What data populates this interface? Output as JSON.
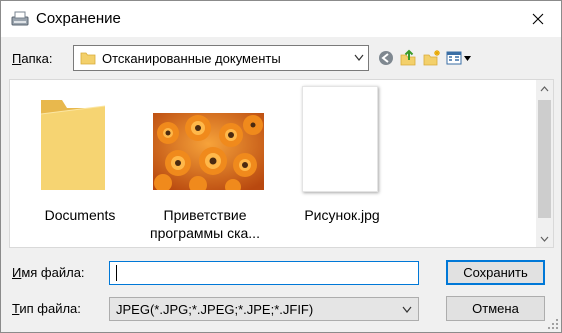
{
  "window": {
    "title": "Сохранение"
  },
  "folder": {
    "label_prefix": "",
    "label_hotkey": "П",
    "label_rest": "апка:",
    "current": "Отсканированные документы"
  },
  "files": [
    {
      "name_line1": "Documents",
      "name_line2": "",
      "kind": "folder"
    },
    {
      "name_line1": "Приветствие",
      "name_line2": "программы ска...",
      "kind": "image"
    },
    {
      "name_line1": "Рисунок.jpg",
      "name_line2": "",
      "kind": "blank"
    }
  ],
  "filename": {
    "label_hotkey": "И",
    "label_rest": "мя файла:",
    "value": ""
  },
  "filetype": {
    "label_hotkey": "Т",
    "label_rest": "ип файла:",
    "value": "JPEG(*.JPG;*.JPEG;*.JPE;*.JFIF)"
  },
  "buttons": {
    "save": "Сохранить",
    "cancel": "Отмена"
  },
  "colors": {
    "accent": "#0078d7",
    "folder_yellow": "#f3d06b"
  },
  "icons": [
    "scanner-icon",
    "close-icon",
    "folder-icon",
    "back-icon",
    "up-folder-icon",
    "new-folder-icon",
    "view-menu-icon",
    "chevron-down-icon",
    "scroll-up-icon",
    "scroll-down-icon"
  ]
}
